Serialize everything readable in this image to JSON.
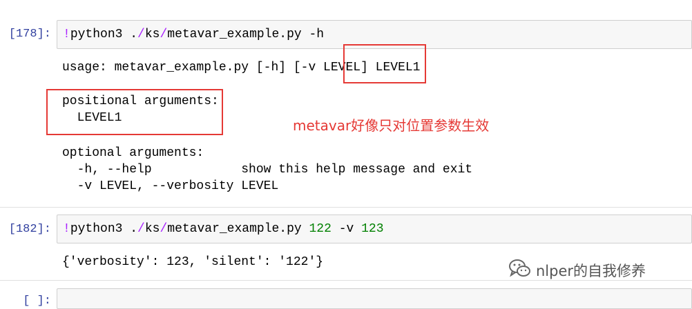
{
  "cells": [
    {
      "prompt": "[178]:",
      "command_bang": "!",
      "command_pre": "python3 .",
      "command_s1": "/",
      "command_dir": "ks",
      "command_s2": "/",
      "command_post": "metavar_example.py -h"
    },
    {
      "prompt": "[182]:",
      "command_bang": "!",
      "command_pre": "python3 .",
      "command_s1": "/",
      "command_dir": "ks",
      "command_s2": "/",
      "command_file": "metavar_example.py ",
      "command_arg1": "122",
      "command_mid": " -v ",
      "command_arg2": "123"
    },
    {
      "prompt": "[  ]:"
    }
  ],
  "output1": {
    "usage": "usage: metavar_example.py [-h] [-v LEVEL] LEVEL1",
    "positional_header": "positional arguments:",
    "positional_item": "  LEVEL1",
    "optional_header": "optional arguments:",
    "help_line": "  -h, --help            show this help message and exit",
    "verbosity_line": "  -v LEVEL, --verbosity LEVEL"
  },
  "output2": {
    "dict": "{'verbosity': 123, 'silent': '122'}"
  },
  "annotation": "metavar好像只对位置参数生效",
  "watermark": {
    "text": "nlper的自我修养",
    "icon": "wechat-icon"
  },
  "colors": {
    "prompt": "#303f9f",
    "highlight_box": "#e53935",
    "magic": "#aa22ff",
    "number": "#008000"
  }
}
